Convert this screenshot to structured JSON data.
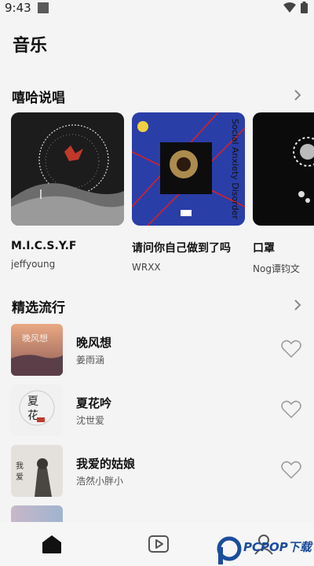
{
  "status": {
    "time": "9:43"
  },
  "page": {
    "title": "音乐"
  },
  "sections": {
    "hiphop": {
      "title": "嘻哈说唱"
    },
    "featured": {
      "title": "精选流行"
    }
  },
  "albums": [
    {
      "title": "M.I.C.S.Y.F",
      "artist": "jeffyoung"
    },
    {
      "title": "请问你自己做到了吗",
      "artist": "WRXX"
    },
    {
      "title": "口罩",
      "artist": "Nog谭钧文"
    }
  ],
  "songs": [
    {
      "title": "晚风想",
      "artist": "姜雨涵"
    },
    {
      "title": "夏花吟",
      "artist": "沈世爱"
    },
    {
      "title": "我爱的姑娘",
      "artist": "浩然小胖小"
    },
    {
      "title": "",
      "artist": ""
    }
  ],
  "watermark": {
    "text": "PCPOP下载"
  },
  "icons": {
    "wifi": "wifi-icon",
    "battery": "battery-icon",
    "more": "chevron-right-icon",
    "heart": "heart-icon",
    "home": "home-icon",
    "video": "video-icon",
    "profile": "profile-icon"
  }
}
